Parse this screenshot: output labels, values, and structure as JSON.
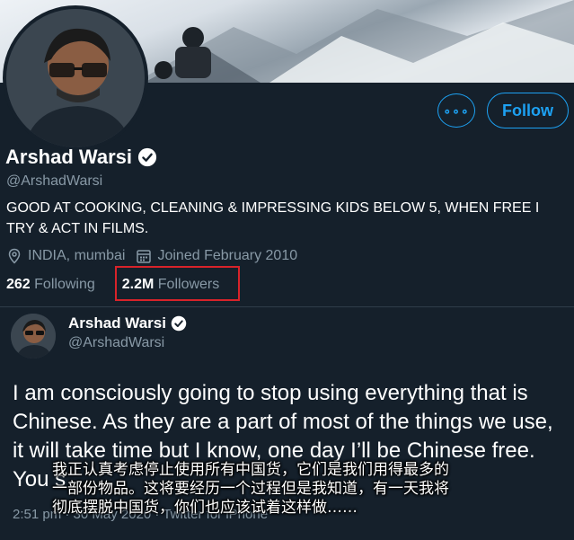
{
  "profile": {
    "name": "Arshad Warsi",
    "handle": "@ArshadWarsi",
    "bio": "GOOD AT COOKING, CLEANING & IMPRESSING KIDS BELOW 5, WHEN FREE I TRY & ACT IN FILMS.",
    "location": "INDIA, mumbai",
    "joined": "Joined February 2010",
    "following_count": "262",
    "following_label": "Following",
    "followers_count": "2.2M",
    "followers_label": "Followers"
  },
  "actions": {
    "more_label": "∘∘∘",
    "follow_label": "Follow"
  },
  "tweet": {
    "name": "Arshad Warsi",
    "handle": "@ArshadWarsi",
    "text": "I am consciously going to stop using everything that is Chinese. As they are a part of most of the things we use, it will take time but I know, one day I’ll be Chinese free. You s",
    "timestamp": "2:51 pm · 30 May 2020 · Twitter for iPhone"
  },
  "subtitle": {
    "line1": "我正认真考虑停止使用所有中国货，它们是我们用得最多的",
    "line2": "一部份物品。这将要经历一个过程但是我知道，有一天我将",
    "line3": "彻底摆脱中国货，你们也应该试着这样做……"
  },
  "colors": {
    "background": "#15202b",
    "accent": "#1da1f2",
    "secondary_text": "#8899a6",
    "highlight_box": "#d8232a"
  },
  "icons": [
    "more-icon",
    "verified-badge-icon",
    "location-pin-icon",
    "calendar-icon"
  ]
}
